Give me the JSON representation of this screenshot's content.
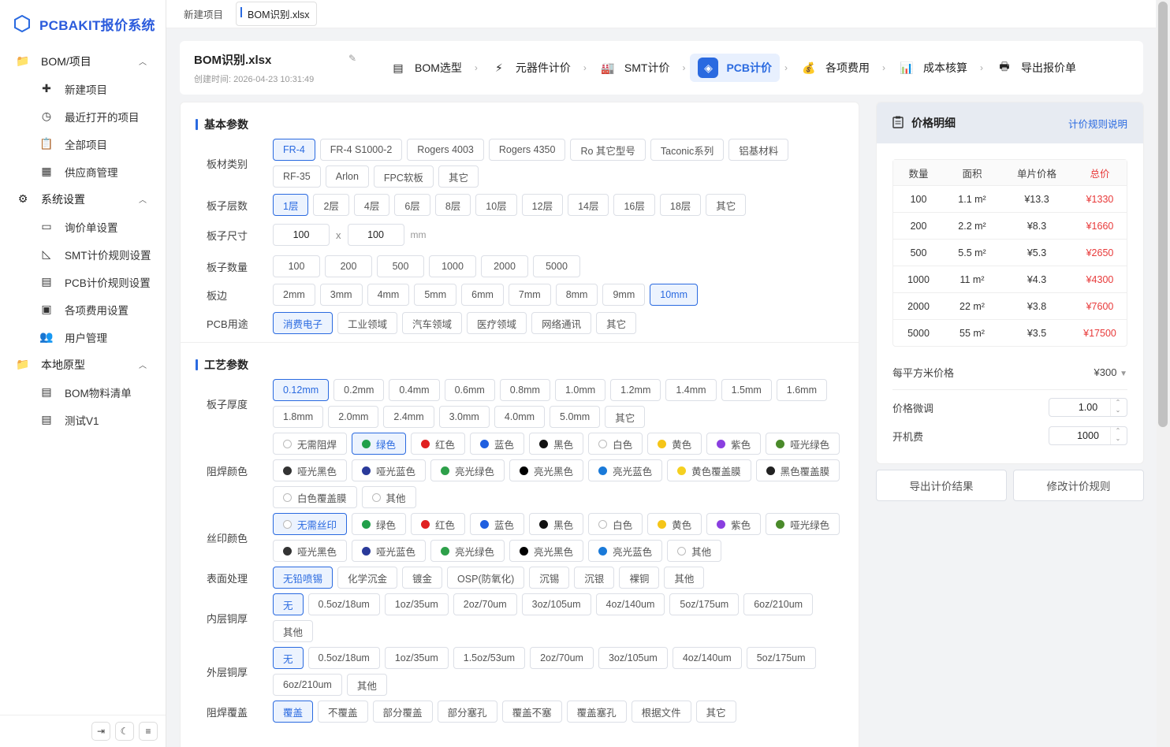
{
  "app": {
    "title": "PCBAKIT报价系统"
  },
  "sidebar": {
    "groups": [
      {
        "title": "BOM/项目",
        "icon": "folder-icon",
        "items": [
          {
            "label": "新建项目",
            "icon": "plus-icon"
          },
          {
            "label": "最近打开的项目",
            "icon": "clock-icon"
          },
          {
            "label": "全部项目",
            "icon": "clipboard-icon"
          },
          {
            "label": "供应商管理",
            "icon": "grid-icon"
          }
        ]
      },
      {
        "title": "系统设置",
        "icon": "gear-icon",
        "items": [
          {
            "label": "询价单设置",
            "icon": "form-icon"
          },
          {
            "label": "SMT计价规则设置",
            "icon": "ruler-icon"
          },
          {
            "label": "PCB计价规则设置",
            "icon": "document-icon"
          },
          {
            "label": "各项费用设置",
            "icon": "money-icon"
          },
          {
            "label": "用户管理",
            "icon": "users-icon"
          }
        ]
      },
      {
        "title": "本地原型",
        "icon": "folder-icon",
        "items": [
          {
            "label": "BOM物料清单",
            "icon": "document-icon"
          },
          {
            "label": "测试V1",
            "icon": "document-icon"
          }
        ]
      }
    ]
  },
  "tabs": [
    "新建项目",
    "BOM识别.xlsx"
  ],
  "project": {
    "title": "BOM识别.xlsx",
    "created": "创建时间: 2026-04-23 10:31:49"
  },
  "steps": [
    {
      "label": "BOM选型",
      "icon": "doc-icon"
    },
    {
      "label": "元器件计价",
      "icon": "bolt-icon"
    },
    {
      "label": "SMT计价",
      "icon": "factory-icon"
    },
    {
      "label": "PCB计价",
      "icon": "chip-icon",
      "active": true
    },
    {
      "label": "各项费用",
      "icon": "moneybag-icon"
    },
    {
      "label": "成本核算",
      "icon": "chart-icon"
    },
    {
      "label": "导出报价单",
      "icon": "printer-icon"
    }
  ],
  "basic": {
    "title": "基本参数",
    "material": {
      "label": "板材类别",
      "options": [
        "FR-4",
        "FR-4 S1000-2",
        "Rogers 4003",
        "Rogers 4350",
        "Ro 其它型号",
        "Taconic系列",
        "铝基材料",
        "RF-35",
        "Arlon",
        "FPC软板",
        "其它"
      ],
      "selected": 0
    },
    "layers": {
      "label": "板子层数",
      "options": [
        "1层",
        "2层",
        "4层",
        "6层",
        "8层",
        "10层",
        "12层",
        "14层",
        "16层",
        "18层",
        "其它"
      ],
      "selected": 0
    },
    "size": {
      "label": "板子尺寸",
      "w": "100",
      "h": "100",
      "x": "x",
      "unit": "mm"
    },
    "qty": {
      "label": "板子数量",
      "options": [
        "100",
        "200",
        "500",
        "1000",
        "2000",
        "5000"
      ]
    },
    "edge": {
      "label": "板边",
      "options": [
        "2mm",
        "3mm",
        "4mm",
        "5mm",
        "6mm",
        "7mm",
        "8mm",
        "9mm",
        "10mm"
      ],
      "selected": 8
    },
    "usage": {
      "label": "PCB用途",
      "options": [
        "消费电子",
        "工业领域",
        "汽车领域",
        "医疗领域",
        "网络通讯",
        "其它"
      ],
      "selected": 0
    }
  },
  "process": {
    "title": "工艺参数",
    "thickness": {
      "label": "板子厚度",
      "options": [
        "0.12mm",
        "0.2mm",
        "0.4mm",
        "0.6mm",
        "0.8mm",
        "1.0mm",
        "1.2mm",
        "1.4mm",
        "1.5mm",
        "1.6mm",
        "1.8mm",
        "2.0mm",
        "2.4mm",
        "3.0mm",
        "4.0mm",
        "5.0mm",
        "其它"
      ],
      "selected": 0
    },
    "mask": {
      "label": "阻焊颜色",
      "selected": 1,
      "options": [
        {
          "t": "无需阻焊",
          "c": ""
        },
        {
          "t": "绿色",
          "c": "#22a04a"
        },
        {
          "t": "红色",
          "c": "#e02020"
        },
        {
          "t": "蓝色",
          "c": "#1f5fe0"
        },
        {
          "t": "黑色",
          "c": "#111111"
        },
        {
          "t": "白色",
          "c": ""
        },
        {
          "t": "黄色",
          "c": "#f5c518"
        },
        {
          "t": "紫色",
          "c": "#8a3fe0"
        },
        {
          "t": "哑光绿色",
          "c": "#4a8a2a"
        },
        {
          "t": "哑光黑色",
          "c": "#333333"
        },
        {
          "t": "哑光蓝色",
          "c": "#2a3a9a"
        },
        {
          "t": "亮光绿色",
          "c": "#2ea04a"
        },
        {
          "t": "亮光黑色",
          "c": "#000000"
        },
        {
          "t": "亮光蓝色",
          "c": "#1a7ad9"
        },
        {
          "t": "黄色覆盖膜",
          "c": "#f5d020"
        },
        {
          "t": "黑色覆盖膜",
          "c": "#222222"
        },
        {
          "t": "白色覆盖膜",
          "c": ""
        },
        {
          "t": "其他",
          "c": ""
        }
      ]
    },
    "silk": {
      "label": "丝印颜色",
      "selected": 0,
      "options": [
        {
          "t": "无需丝印",
          "c": ""
        },
        {
          "t": "绿色",
          "c": "#22a04a"
        },
        {
          "t": "红色",
          "c": "#e02020"
        },
        {
          "t": "蓝色",
          "c": "#1f5fe0"
        },
        {
          "t": "黑色",
          "c": "#111111"
        },
        {
          "t": "白色",
          "c": ""
        },
        {
          "t": "黄色",
          "c": "#f5c518"
        },
        {
          "t": "紫色",
          "c": "#8a3fe0"
        },
        {
          "t": "哑光绿色",
          "c": "#4a8a2a"
        },
        {
          "t": "哑光黑色",
          "c": "#333333"
        },
        {
          "t": "哑光蓝色",
          "c": "#2a3a9a"
        },
        {
          "t": "亮光绿色",
          "c": "#2ea04a"
        },
        {
          "t": "亮光黑色",
          "c": "#000000"
        },
        {
          "t": "亮光蓝色",
          "c": "#1a7ad9"
        },
        {
          "t": "其他",
          "c": ""
        }
      ]
    },
    "finish": {
      "label": "表面处理",
      "options": [
        "无铅喷锡",
        "化学沉金",
        "镀金",
        "OSP(防氧化)",
        "沉锡",
        "沉银",
        "裸铜",
        "其他"
      ],
      "selected": 0
    },
    "inner": {
      "label": "内层铜厚",
      "options": [
        "无",
        "0.5oz/18um",
        "1oz/35um",
        "2oz/70um",
        "3oz/105um",
        "4oz/140um",
        "5oz/175um",
        "6oz/210um",
        "其他"
      ],
      "selected": 0
    },
    "outer": {
      "label": "外层铜厚",
      "options": [
        "无",
        "0.5oz/18um",
        "1oz/35um",
        "1.5oz/53um",
        "2oz/70um",
        "3oz/105um",
        "4oz/140um",
        "5oz/175um",
        "6oz/210um",
        "其他"
      ],
      "selected": 0
    },
    "cover": {
      "label": "阻焊覆盖",
      "options": [
        "覆盖",
        "不覆盖",
        "部分覆盖",
        "部分塞孔",
        "覆盖不塞",
        "覆盖塞孔",
        "根据文件",
        "其它"
      ],
      "selected": 0
    }
  },
  "price": {
    "title": "价格明细",
    "link": "计价规则说明",
    "headers": [
      "数量",
      "面积",
      "单片价格",
      "总价"
    ],
    "rows": [
      [
        "100",
        "1.1 m²",
        "¥13.3",
        "¥1330"
      ],
      [
        "200",
        "2.2 m²",
        "¥8.3",
        "¥1660"
      ],
      [
        "500",
        "5.5 m²",
        "¥5.3",
        "¥2650"
      ],
      [
        "1000",
        "11 m²",
        "¥4.3",
        "¥4300"
      ],
      [
        "2000",
        "22 m²",
        "¥3.8",
        "¥7600"
      ],
      [
        "5000",
        "55 m²",
        "¥3.5",
        "¥17500"
      ]
    ],
    "per_sqm_label": "每平方米价格",
    "per_sqm_value": "¥300",
    "adjust_label": "价格微调",
    "adjust_value": "1.00",
    "setup_label": "开机费",
    "setup_value": "1000",
    "export_btn": "导出计价结果",
    "modify_btn": "修改计价规则"
  },
  "colors": {
    "accent": "#2a6ae0",
    "red": "#e83a3a"
  }
}
